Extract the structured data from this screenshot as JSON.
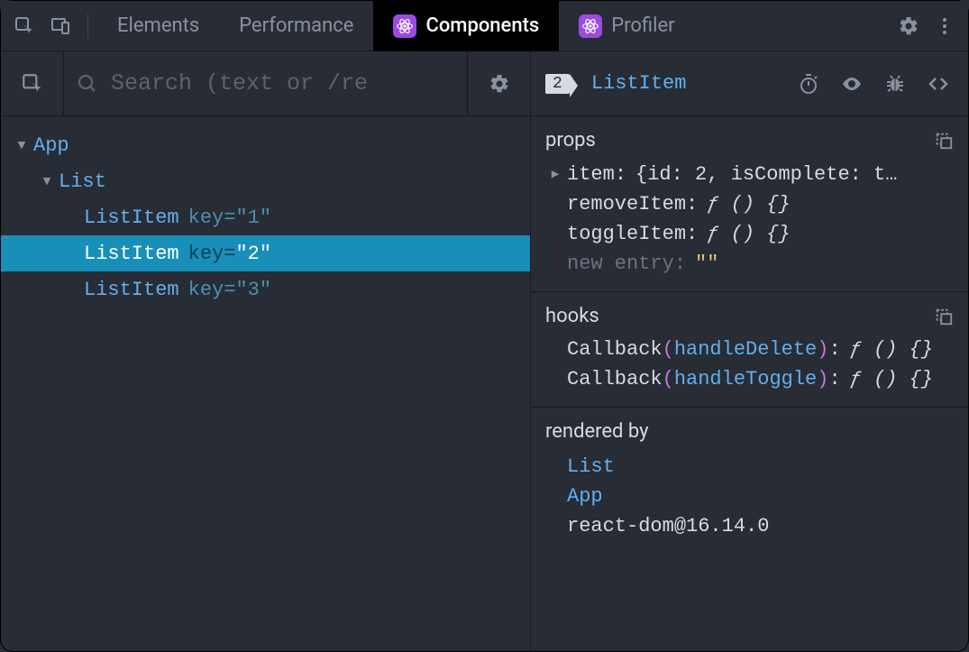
{
  "tabs": {
    "elements": "Elements",
    "performance": "Performance",
    "components": "Components",
    "profiler": "Profiler"
  },
  "search": {
    "placeholder": "Search (text or /re"
  },
  "tree": {
    "root": "App",
    "list": "List",
    "items": [
      {
        "name": "ListItem",
        "keyLabel": "key",
        "keyValue": "\"1\"",
        "selected": false
      },
      {
        "name": "ListItem",
        "keyLabel": "key",
        "keyValue": "\"2\"",
        "selected": true
      },
      {
        "name": "ListItem",
        "keyLabel": "key",
        "keyValue": "\"3\"",
        "selected": false
      }
    ]
  },
  "inspector": {
    "depthBadge": "2",
    "componentName": "ListItem"
  },
  "propsSection": {
    "title": "props",
    "item": {
      "key": "item",
      "value": "{id: 2, isComplete: t…"
    },
    "removeItem": {
      "key": "removeItem",
      "value": "ƒ () {}"
    },
    "toggleItem": {
      "key": "toggleItem",
      "value": "ƒ () {}"
    },
    "newEntry": {
      "key": "new entry",
      "value": "\"\""
    }
  },
  "hooksSection": {
    "title": "hooks",
    "rows": [
      {
        "cbLabel": "Callback",
        "arg": "handleDelete",
        "value": "ƒ () {}"
      },
      {
        "cbLabel": "Callback",
        "arg": "handleToggle",
        "value": "ƒ () {}"
      }
    ]
  },
  "renderedBy": {
    "title": "rendered by",
    "chain": [
      "List",
      "App"
    ],
    "runtime": "react-dom@16.14.0"
  }
}
